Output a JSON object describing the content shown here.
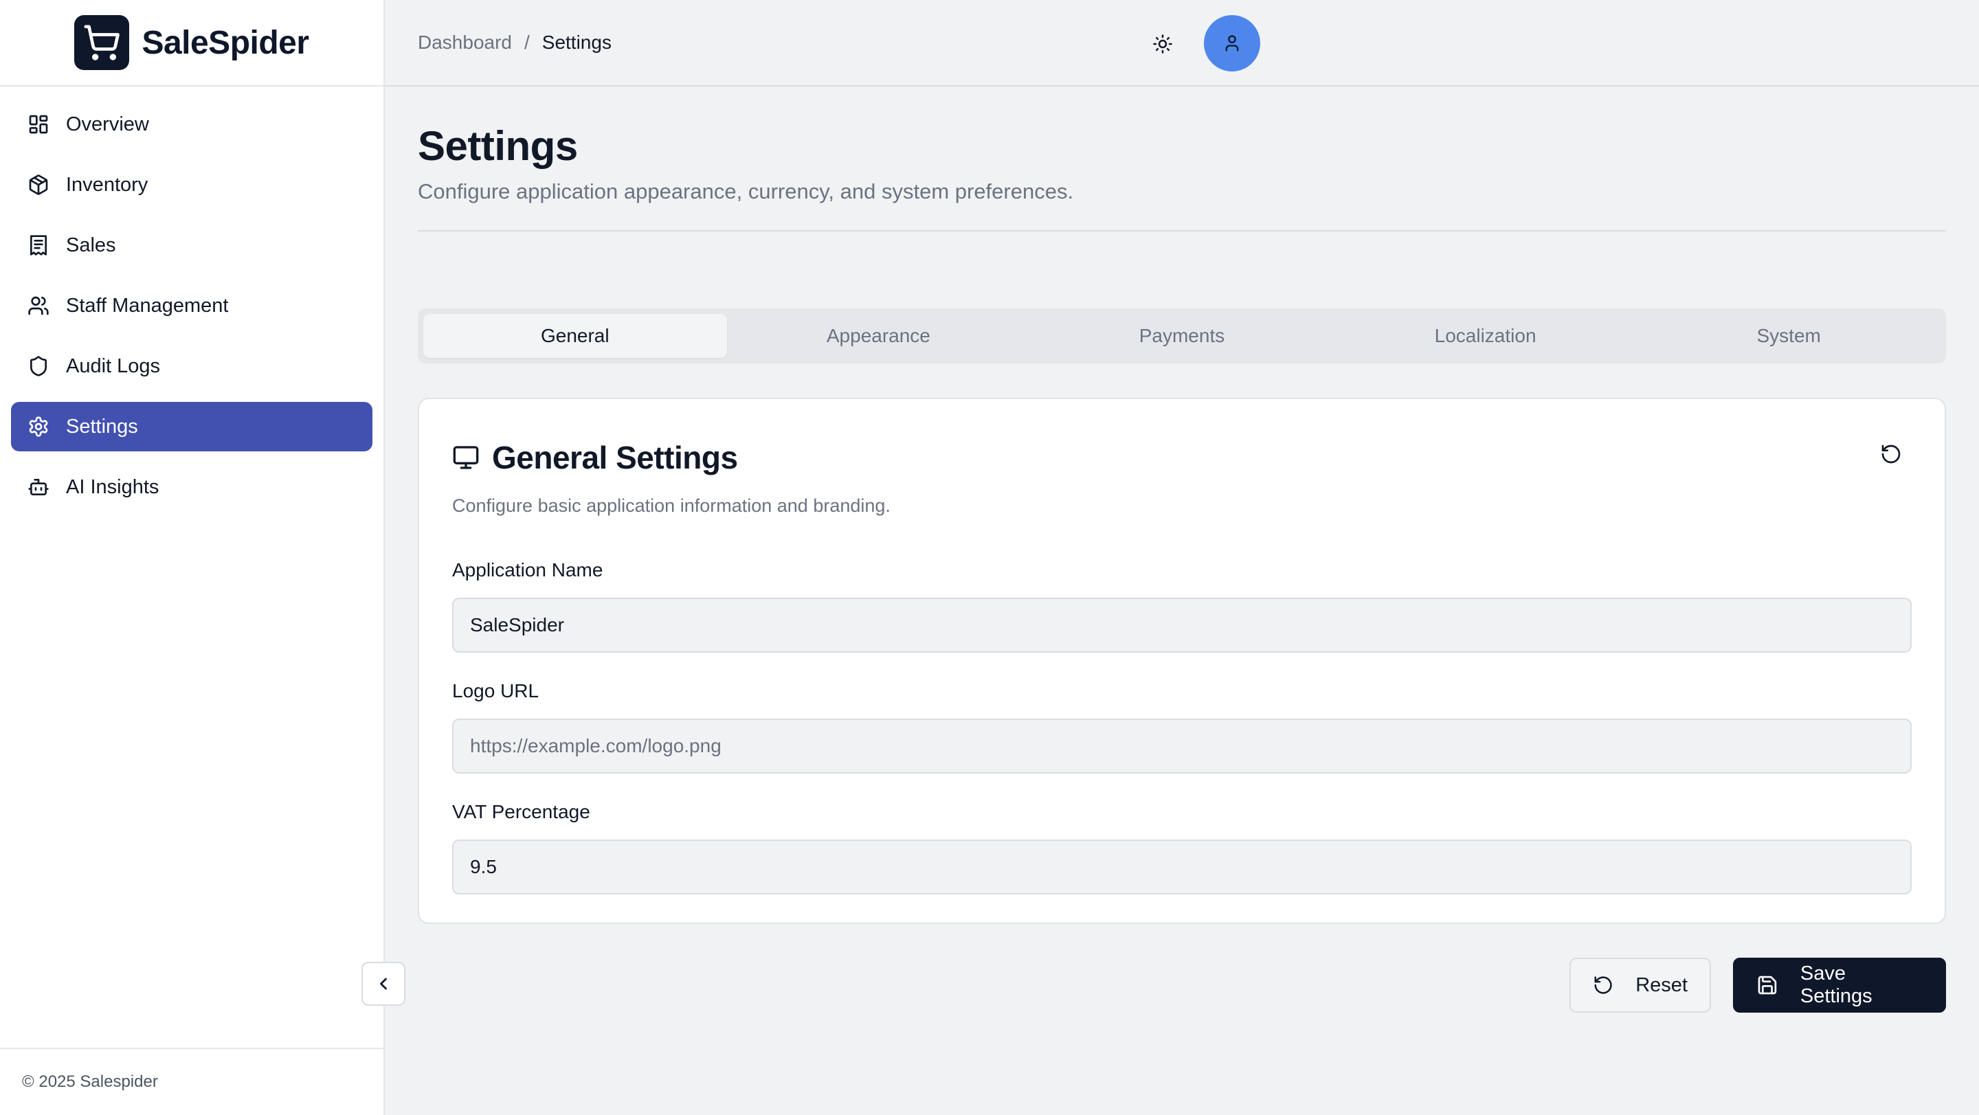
{
  "brand": {
    "name": "SaleSpider"
  },
  "sidebar": {
    "items": [
      {
        "label": "Overview",
        "icon": "grid-icon"
      },
      {
        "label": "Inventory",
        "icon": "package-icon"
      },
      {
        "label": "Sales",
        "icon": "receipt-icon"
      },
      {
        "label": "Staff Management",
        "icon": "users-icon"
      },
      {
        "label": "Audit Logs",
        "icon": "shield-icon"
      },
      {
        "label": "Settings",
        "icon": "gear-icon",
        "active": true
      },
      {
        "label": "AI Insights",
        "icon": "bot-icon"
      }
    ],
    "footer": "© 2025 Salespider"
  },
  "header": {
    "breadcrumb": {
      "parent": "Dashboard",
      "separator": "/",
      "current": "Settings"
    }
  },
  "page": {
    "title": "Settings",
    "subtitle": "Configure application appearance, currency, and system preferences."
  },
  "tabs": [
    {
      "label": "General",
      "active": true
    },
    {
      "label": "Appearance"
    },
    {
      "label": "Payments"
    },
    {
      "label": "Localization"
    },
    {
      "label": "System"
    }
  ],
  "card": {
    "title": "General Settings",
    "description": "Configure basic application information and branding.",
    "fields": {
      "app_name": {
        "label": "Application Name",
        "value": "SaleSpider"
      },
      "logo_url": {
        "label": "Logo URL",
        "value": "",
        "placeholder": "https://example.com/logo.png"
      },
      "vat": {
        "label": "VAT Percentage",
        "value": "9.5"
      }
    }
  },
  "actions": {
    "reset_label": "Reset",
    "save_label": "Save Settings"
  },
  "colors": {
    "accent": "#4250b0",
    "primary_button": "#0f172a",
    "avatar": "#4e86ec",
    "background": "#f1f2f4"
  }
}
